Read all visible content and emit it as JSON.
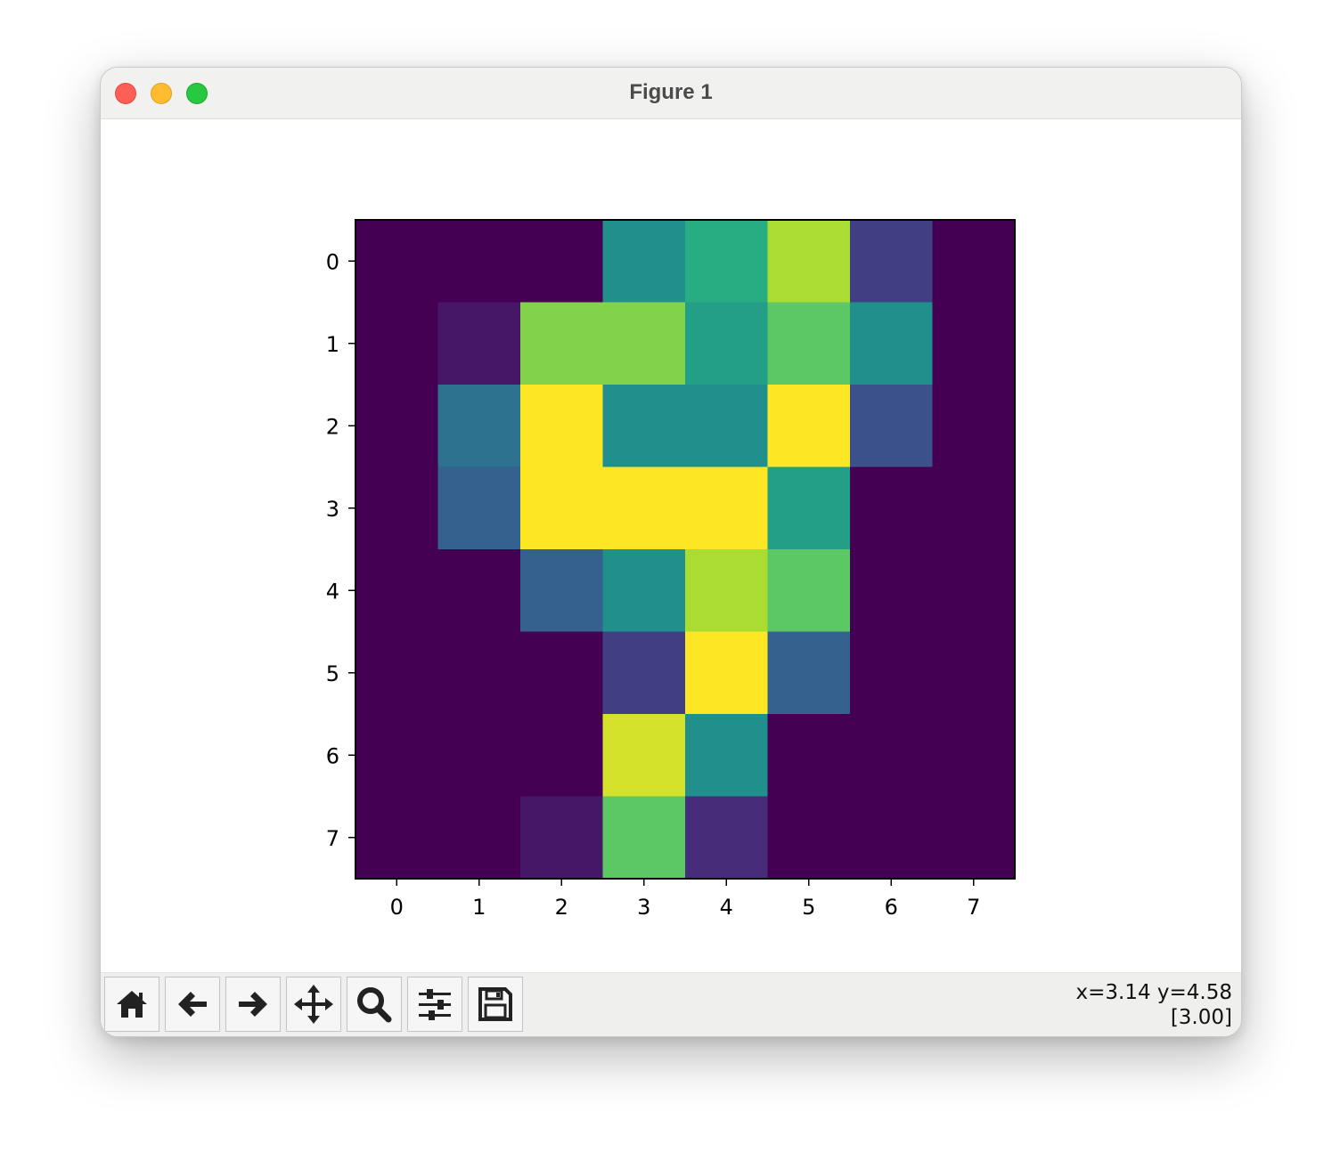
{
  "window": {
    "title": "Figure 1"
  },
  "toolbar": {
    "buttons": [
      {
        "name": "home-icon"
      },
      {
        "name": "back-arrow-icon"
      },
      {
        "name": "forward-arrow-icon"
      },
      {
        "name": "pan-move-icon"
      },
      {
        "name": "zoom-magnifier-icon"
      },
      {
        "name": "configure-subplots-icon"
      },
      {
        "name": "save-floppy-icon"
      }
    ],
    "cursor_readout": "x=3.14 y=4.58",
    "pixel_value": "[3.00]"
  },
  "chart_data": {
    "type": "heatmap",
    "colormap": "viridis",
    "x_ticks": [
      "0",
      "1",
      "2",
      "3",
      "4",
      "5",
      "6",
      "7"
    ],
    "y_ticks": [
      "0",
      "1",
      "2",
      "3",
      "4",
      "5",
      "6",
      "7"
    ],
    "vmin": 0,
    "vmax": 16,
    "values": [
      [
        0,
        0,
        0,
        8,
        10,
        14,
        3,
        0
      ],
      [
        0,
        1,
        13,
        13,
        9,
        12,
        8,
        0
      ],
      [
        0,
        6,
        16,
        8,
        8,
        16,
        4,
        0
      ],
      [
        0,
        5,
        16,
        16,
        16,
        9,
        0,
        0
      ],
      [
        0,
        0,
        5,
        8,
        14,
        12,
        0,
        0
      ],
      [
        0,
        0,
        0,
        3,
        16,
        5,
        0,
        0
      ],
      [
        0,
        0,
        0,
        15,
        8,
        0,
        0,
        0
      ],
      [
        0,
        0,
        1,
        12,
        2,
        0,
        0,
        0
      ]
    ]
  }
}
